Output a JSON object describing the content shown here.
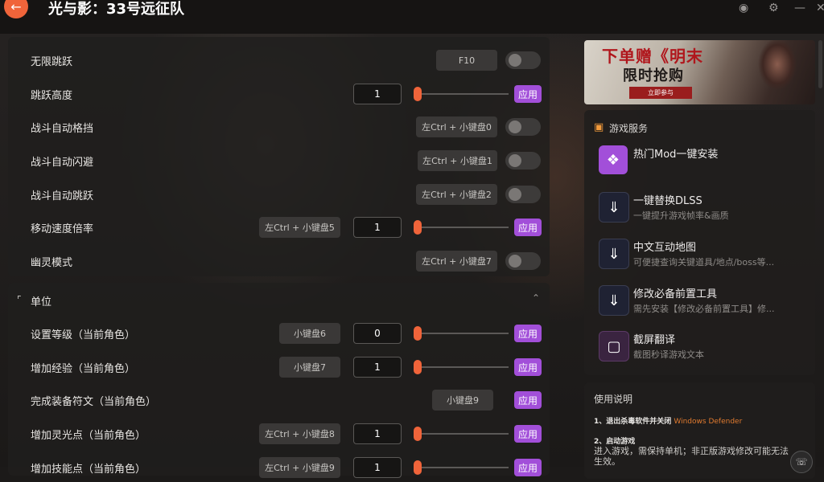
{
  "app": {
    "title": "光与影：33号远征队",
    "back_icon": "arrow-left-icon",
    "accent_color": "#f0643a",
    "apply_color": "#a24fd9"
  },
  "panel1": {
    "rows": [
      {
        "label": "无限跳跃",
        "hotkey": "F10",
        "control": "toggle"
      },
      {
        "label": "跳跃高度",
        "value": "1",
        "control": "slider-apply"
      },
      {
        "label": "战斗自动格挡",
        "hotkey": "左Ctrl + 小键盘0",
        "control": "toggle"
      },
      {
        "label": "战斗自动闪避",
        "hotkey": "左Ctrl + 小键盘1",
        "control": "toggle"
      },
      {
        "label": "战斗自动跳跃",
        "hotkey": "左Ctrl + 小键盘2",
        "control": "toggle"
      },
      {
        "label": "移动速度倍率",
        "hotkey": "左Ctrl + 小键盘5",
        "value": "1",
        "control": "slider-apply"
      },
      {
        "label": "幽灵模式",
        "hotkey": "左Ctrl + 小键盘7",
        "control": "toggle"
      }
    ]
  },
  "panel2": {
    "header": "单位",
    "rows": [
      {
        "label": "设置等级（当前角色）",
        "hotkey": "小键盘6",
        "value": "0"
      },
      {
        "label": "增加经验（当前角色）",
        "hotkey": "小键盘7",
        "value": "1"
      },
      {
        "label": "完成装备符文（当前角色）",
        "hotkey": "小键盘9"
      },
      {
        "label": "增加灵光点（当前角色）",
        "hotkey": "左Ctrl + 小键盘8",
        "value": "1"
      },
      {
        "label": "增加技能点（当前角色）",
        "hotkey": "左Ctrl + 小键盘9",
        "value": "1"
      }
    ]
  },
  "apply_label": "应用",
  "banner": {
    "title": "下单赠《明末",
    "subtitle": "限时抢购",
    "button": "立即参与"
  },
  "services": {
    "title": "游戏服务",
    "items": [
      {
        "title": "热门Mod一键安装",
        "desc": "",
        "icon": "mod-icon"
      },
      {
        "title": "一键替换DLSS",
        "desc": "一键提升游戏帧率&画质",
        "icon": "download-icon"
      },
      {
        "title": "中文互动地图",
        "desc": "可便捷查询关键道具/地点/boss等...",
        "icon": "download-icon"
      },
      {
        "title": "修改必备前置工具",
        "desc": "需先安装【修改必备前置工具】修...",
        "icon": "download-icon"
      },
      {
        "title": "截屏翻译",
        "desc": "截图秒译游戏文本",
        "icon": "translate-icon"
      }
    ]
  },
  "instructions": {
    "title": "使用说明",
    "step1_prefix": "1、退出杀毒软件并关闭",
    "step1_highlight": "Windows Defender",
    "step2_title": "2、启动游戏",
    "step2_body": "进入游戏，需保持单机；非正版游戏修改可能无法生效。"
  }
}
